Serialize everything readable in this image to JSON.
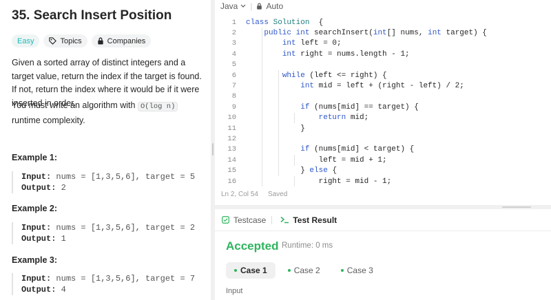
{
  "problem": {
    "title": "35. Search Insert Position",
    "difficulty": "Easy",
    "topics_label": "Topics",
    "companies_label": "Companies",
    "description": "Given a sorted array of distinct integers and a target value, return the index if the target is found. If not, return the index where it would be if it were inserted in order.",
    "complexity_prefix": "You must write an algorithm with",
    "complexity_code": "O(log n)",
    "complexity_suffix": "runtime complexity.",
    "examples": [
      {
        "title": "Example 1:",
        "input_label": "Input:",
        "input": "nums = [1,3,5,6], target = 5",
        "output_label": "Output:",
        "output": "2"
      },
      {
        "title": "Example 2:",
        "input_label": "Input:",
        "input": "nums = [1,3,5,6], target = 2",
        "output_label": "Output:",
        "output": "1"
      },
      {
        "title": "Example 3:",
        "input_label": "Input:",
        "input": "nums = [1,3,5,6], target = 7",
        "output_label": "Output:",
        "output": "4"
      }
    ]
  },
  "editor": {
    "language": "Java",
    "mode": "Auto",
    "status_position": "Ln 2, Col 54",
    "status_saved": "Saved",
    "lines": [
      {
        "n": "1",
        "t": [
          [
            "kw",
            "class "
          ],
          [
            "cl",
            "Solution"
          ],
          [
            "",
            "  {"
          ]
        ]
      },
      {
        "n": "2",
        "t": [
          [
            "",
            "    "
          ],
          [
            "kw",
            "public "
          ],
          [
            "ty",
            "int "
          ],
          [
            "",
            "searchInsert("
          ],
          [
            "ty",
            "int"
          ],
          [
            "",
            "[] nums, "
          ],
          [
            "ty",
            "int "
          ],
          [
            "",
            "target) {"
          ]
        ]
      },
      {
        "n": "3",
        "t": [
          [
            "",
            "        "
          ],
          [
            "ty",
            "int "
          ],
          [
            "",
            "left = 0;"
          ]
        ]
      },
      {
        "n": "4",
        "t": [
          [
            "",
            "        "
          ],
          [
            "ty",
            "int "
          ],
          [
            "",
            "right = nums.length - 1;"
          ]
        ]
      },
      {
        "n": "5",
        "t": [
          [
            "",
            ""
          ]
        ]
      },
      {
        "n": "6",
        "t": [
          [
            "",
            "        "
          ],
          [
            "kw",
            "while "
          ],
          [
            "",
            "(left <= right) {"
          ]
        ]
      },
      {
        "n": "7",
        "t": [
          [
            "",
            "            "
          ],
          [
            "ty",
            "int "
          ],
          [
            "",
            "mid = left + (right - left) / 2;"
          ]
        ]
      },
      {
        "n": "8",
        "t": [
          [
            "",
            ""
          ]
        ]
      },
      {
        "n": "9",
        "t": [
          [
            "",
            "            "
          ],
          [
            "kw",
            "if "
          ],
          [
            "",
            "(nums[mid] == target) {"
          ]
        ]
      },
      {
        "n": "10",
        "t": [
          [
            "",
            "                "
          ],
          [
            "kw",
            "return "
          ],
          [
            "",
            "mid;"
          ]
        ]
      },
      {
        "n": "11",
        "t": [
          [
            "",
            "            }"
          ]
        ]
      },
      {
        "n": "12",
        "t": [
          [
            "",
            ""
          ]
        ]
      },
      {
        "n": "13",
        "t": [
          [
            "",
            "            "
          ],
          [
            "kw",
            "if "
          ],
          [
            "",
            "(nums[mid] < target) {"
          ]
        ]
      },
      {
        "n": "14",
        "t": [
          [
            "",
            "                left = mid + 1;"
          ]
        ]
      },
      {
        "n": "15",
        "t": [
          [
            "",
            "            } "
          ],
          [
            "kw",
            "else "
          ],
          [
            "",
            "{"
          ]
        ]
      },
      {
        "n": "16",
        "t": [
          [
            "",
            "                right = mid - 1;"
          ]
        ]
      }
    ]
  },
  "testpanel": {
    "testcase_tab": "Testcase",
    "result_tab": "Test Result",
    "verdict": "Accepted",
    "runtime": "Runtime: 0 ms",
    "cases": [
      "Case 1",
      "Case 2",
      "Case 3"
    ],
    "input_label": "Input"
  }
}
